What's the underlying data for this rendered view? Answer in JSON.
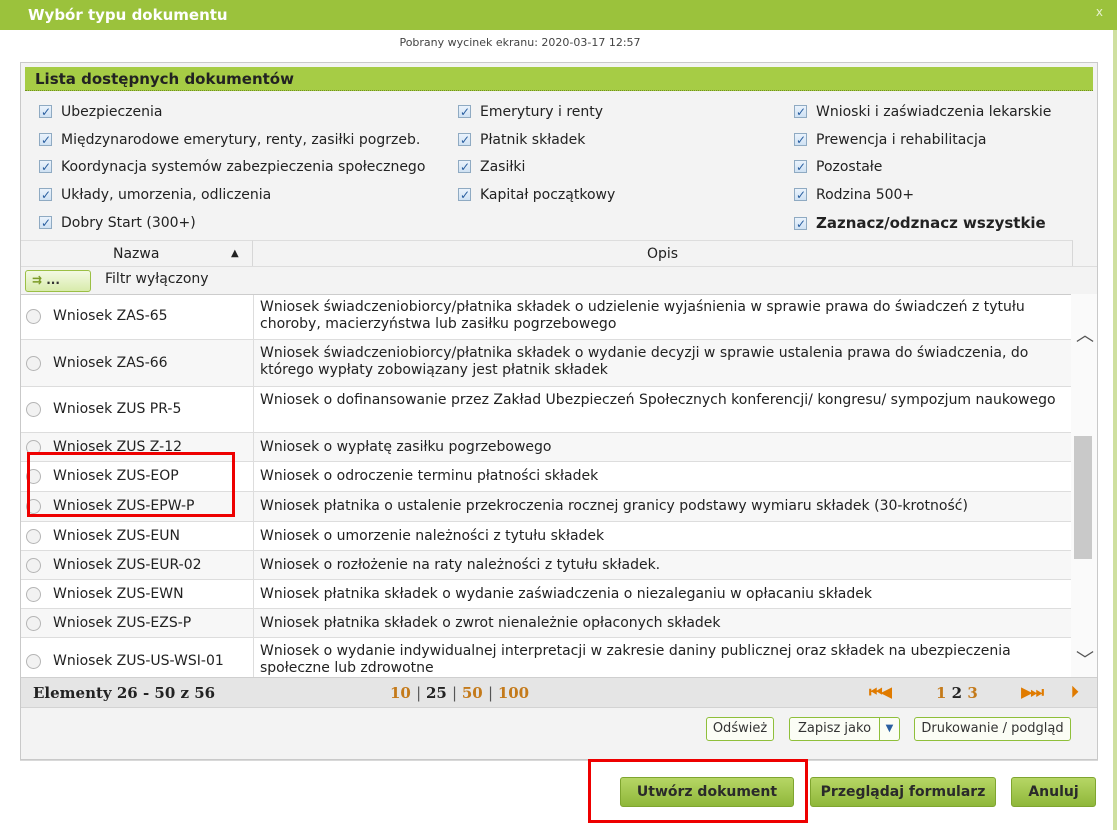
{
  "window": {
    "title": "Wybór typu dokumentu",
    "close_glyph": "x",
    "caption": "Pobrany wycinek ekranu: 2020-03-17 12:57"
  },
  "panel": {
    "title": "Lista dostępnych dokumentów"
  },
  "categories": [
    {
      "label": "Ubezpieczenia",
      "checked": true
    },
    {
      "label": "Emerytury i renty",
      "checked": true
    },
    {
      "label": "Wnioski i zaświadczenia lekarskie",
      "checked": true
    },
    {
      "label": "Międzynarodowe emerytury, renty, zasiłki pogrzeb.",
      "checked": true
    },
    {
      "label": "Płatnik składek",
      "checked": true
    },
    {
      "label": "Prewencja i rehabilitacja",
      "checked": true
    },
    {
      "label": "Koordynacja systemów zabezpieczenia społecznego",
      "checked": true
    },
    {
      "label": "Zasiłki",
      "checked": true
    },
    {
      "label": "Pozostałe",
      "checked": true
    },
    {
      "label": "Układy, umorzenia, odliczenia",
      "checked": true
    },
    {
      "label": "Kapitał początkowy",
      "checked": true
    },
    {
      "label": "Rodzina 500+",
      "checked": true
    },
    {
      "label": "Dobry Start (300+)",
      "checked": true
    },
    {
      "label": "Zaznacz/odznacz wszystkie",
      "checked": true
    }
  ],
  "table": {
    "columns": {
      "name": "Nazwa",
      "description": "Opis"
    },
    "sort_glyph": "▲",
    "filter": {
      "button_glyph": "⇉",
      "button_dots": "...",
      "label": "Filtr wyłączony"
    },
    "rows": [
      {
        "name": "Wniosek ZAS-65",
        "description": "Wniosek świadczeniobiorcy/płatnika składek o udzielenie wyjaśnienia w sprawie prawa do świadczeń z tytułu choroby, macierzyństwa lub zasiłku pogrzebowego"
      },
      {
        "name": "Wniosek ZAS-66",
        "description": "Wniosek świadczeniobiorcy/płatnika składek o wydanie decyzji w sprawie ustalenia prawa do świadczenia, do którego wypłaty zobowiązany jest płatnik składek"
      },
      {
        "name": "Wniosek ZUS PR-5",
        "description": "Wniosek o dofinansowanie przez Zakład Ubezpieczeń Społecznych konferencji/ kongresu/ sympozjum naukowego"
      },
      {
        "name": "Wniosek ZUS Z-12",
        "description": "Wniosek o wypłatę zasiłku pogrzebowego"
      },
      {
        "name": "Wniosek ZUS-EOP",
        "description": "Wniosek o odroczenie terminu płatności składek"
      },
      {
        "name": "Wniosek ZUS-EPW-P",
        "description": "Wniosek płatnika o ustalenie przekroczenia rocznej granicy podstawy wymiaru składek (30-krotność)"
      },
      {
        "name": "Wniosek ZUS-EUN",
        "description": "Wniosek o umorzenie należności z tytułu składek"
      },
      {
        "name": "Wniosek ZUS-EUR-02",
        "description": "Wniosek o rozłożenie na raty należności z tytułu składek."
      },
      {
        "name": "Wniosek ZUS-EWN",
        "description": "Wniosek płatnika składek o wydanie zaświadczenia o niezaleganiu w opłacaniu składek"
      },
      {
        "name": "Wniosek ZUS-EZS-P",
        "description": "Wniosek płatnika składek o zwrot nienależnie opłaconych składek"
      },
      {
        "name": "Wniosek ZUS-US-WSI-01",
        "description": "Wniosek o wydanie indywidualnej interpretacji w zakresie daniny publicznej oraz składek na ubezpieczenia społeczne lub zdrowotne"
      }
    ]
  },
  "pager": {
    "count": "Elementy 26 - 50 z 56",
    "sizes": [
      "10",
      "25",
      "50",
      "100"
    ],
    "current_size": "25",
    "first_glyph": "⏮",
    "prev_glyph": "◀",
    "pages": [
      "1",
      "2",
      "3"
    ],
    "current_page": "2",
    "next_glyph": "▶",
    "last_glyph": "⏭",
    "end_glyph": "⏵"
  },
  "toolbar": {
    "refresh": "Odśwież",
    "save_as": "Zapisz jako",
    "dropdown_glyph": "▼",
    "print": "Drukowanie / podgląd"
  },
  "footer": {
    "create": "Utwórz dokument",
    "browse": "Przeglądaj formularz",
    "cancel": "Anuluj"
  },
  "colors": {
    "accent_green": "#9bc23c",
    "highlight_red": "#ee0000",
    "pager_orange": "#c47a1a"
  }
}
